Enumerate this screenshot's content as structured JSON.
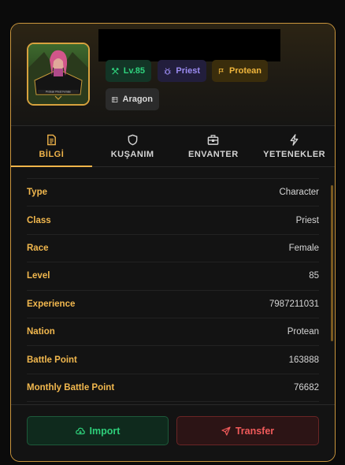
{
  "colors": {
    "accent": "#f0b44a",
    "border": "#c9953d",
    "level": "#2fd47e",
    "class": "#9c8cf2",
    "nation": "#f0b63c",
    "import": "#2ecf7a",
    "transfer": "#f05a5a"
  },
  "profile": {
    "avatar_caption": "Protean Priest Female",
    "badges": {
      "level": {
        "label": "Lv.85",
        "icon": "crossed-swords-icon"
      },
      "class": {
        "label": "Priest",
        "icon": "bug-icon"
      },
      "nation": {
        "label": "Protean",
        "icon": "flag-icon"
      },
      "server": {
        "label": "Aragon",
        "icon": "server-icon"
      }
    }
  },
  "tabs": [
    {
      "label": "BİLGİ",
      "icon": "document-icon",
      "active": true
    },
    {
      "label": "KUŞANIM",
      "icon": "shield-icon",
      "active": false
    },
    {
      "label": "ENVANTER",
      "icon": "briefcase-icon",
      "active": false
    },
    {
      "label": "YETENEKLER",
      "icon": "lightning-icon",
      "active": false
    }
  ],
  "info": [
    {
      "key": "Type",
      "value": "Character"
    },
    {
      "key": "Class",
      "value": "Priest"
    },
    {
      "key": "Race",
      "value": "Female"
    },
    {
      "key": "Level",
      "value": "85"
    },
    {
      "key": "Experience",
      "value": "7987211031"
    },
    {
      "key": "Nation",
      "value": "Protean"
    },
    {
      "key": "Battle Point",
      "value": "163888"
    },
    {
      "key": "Monthly Battle Point",
      "value": "76682"
    }
  ],
  "actions": {
    "import_label": "Import",
    "transfer_label": "Transfer"
  }
}
